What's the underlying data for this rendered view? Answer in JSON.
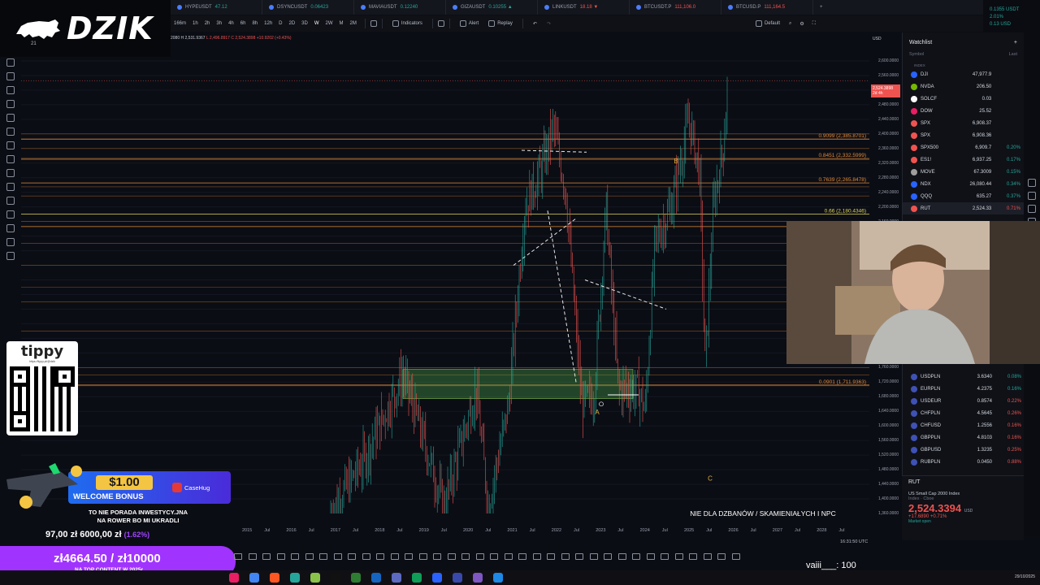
{
  "logo": {
    "text": "DZIK"
  },
  "tabs": [
    {
      "symbol": "HYPEUSDT",
      "value": "47.12",
      "neg": false
    },
    {
      "symbol": "DSYNCUSDT",
      "value": "0.06423",
      "neg": false
    },
    {
      "symbol": "MAVIAUSDT",
      "value": "0.12240",
      "neg": false
    },
    {
      "symbol": "GIZAUSDT",
      "value": "0.10255 ▲",
      "neg": false
    },
    {
      "symbol": "LINKUSDT",
      "value": "18.18 ▼",
      "neg": true
    },
    {
      "symbol": "BTCUSDT.P",
      "value": "111,106.0",
      "neg": true
    },
    {
      "symbol": "BTCUSD.P",
      "value": "111,164.5",
      "neg": true
    }
  ],
  "toolbar": {
    "timeframes": [
      "166m",
      "1h",
      "2h",
      "3h",
      "4h",
      "6h",
      "8h",
      "12h",
      "D",
      "2D",
      "3D",
      "W",
      "2W",
      "M",
      "2M"
    ],
    "indicators_label": "Indicators",
    "alert_label": "Alert",
    "replay_label": "Replay",
    "layout_label": "Default"
  },
  "corner": {
    "line1": "0.1355 USDT",
    "line2": "2.01%",
    "line3": "0.13 USD"
  },
  "ohlc": {
    "o": "2080",
    "h": "H 2,531.9367",
    "l": "L 2,496.8917",
    "c": "C 2,524.3898",
    "chg": "+10.9202 (+0.43%)"
  },
  "indicator_count": "21",
  "price_axis": {
    "currency": "USD",
    "current": "2,524.3898",
    "current_sub": "2d 4h",
    "labels": [
      "2,600.0000",
      "2,560.0000",
      "2,520.0000",
      "2,480.0000",
      "2,440.0000",
      "2,400.0000",
      "2,360.0000",
      "2,320.0000",
      "2,280.0000",
      "2,240.0000",
      "2,200.0000",
      "2,160.0000",
      "2,120.0000",
      "2,080.0000",
      "2,040.0000",
      "2,000.0000",
      "1,960.0000",
      "1,920.0000",
      "1,880.0000",
      "1,840.0000",
      "1,800.0000",
      "1,760.0000",
      "1,720.0000",
      "1,680.0000",
      "1,640.0000",
      "1,600.0000",
      "1,560.0000",
      "1,520.0000",
      "1,480.0000",
      "1,440.0000",
      "1,400.0000",
      "1,360.0000"
    ]
  },
  "time_axis": [
    "2015",
    "Jul",
    "2016",
    "Jul",
    "2017",
    "Jul",
    "2018",
    "Jul",
    "2019",
    "Jul",
    "2020",
    "Jul",
    "2021",
    "Jul",
    "2022",
    "Jul",
    "2023",
    "Jul",
    "2024",
    "Jul",
    "2025",
    "Jul",
    "2026",
    "Jul",
    "2027",
    "Jul",
    "2028",
    "Jul"
  ],
  "clock": "16:31:50 UTC",
  "chart_data": {
    "type": "candlestick",
    "fib_levels": [
      {
        "label": "0.9099 (2,385.8701)",
        "value": 2385.8701
      },
      {
        "label": "0.8451 (2,332.5999)",
        "value": 2332.5999
      },
      {
        "label": "0.7639 (2,265.8478)",
        "value": 2265.8478
      },
      {
        "label": "0.66 (2,180.4346)",
        "value": 2180.4346
      },
      {
        "label": "0.61818 (2,146.0556)",
        "value": 2146.0556
      },
      {
        "label": "0.0901 (1,711.9363)",
        "value": 1711.9363
      }
    ],
    "wave_labels": [
      "A",
      "B",
      "C"
    ],
    "ylim": [
      1360,
      2600
    ]
  },
  "watchlist": {
    "title": "Watchlist",
    "col_symbol": "Symbol",
    "col_last": "Last",
    "group": "INDEX",
    "rows": [
      {
        "sym": "DJI",
        "last": "47,977.9",
        "chg": "",
        "color": "#2962ff",
        "neg": false
      },
      {
        "sym": "NVDA",
        "last": "206.50",
        "chg": "",
        "color": "#76b900",
        "neg": false
      },
      {
        "sym": "SOLCF",
        "last": "0.03",
        "chg": "",
        "color": "#ffffff",
        "neg": false
      },
      {
        "sym": "DOW",
        "last": "25.52",
        "chg": "",
        "color": "#e91e63",
        "neg": false
      },
      {
        "sym": "SPX",
        "last": "6,908.37",
        "chg": "",
        "color": "#ef5350",
        "neg": false
      },
      {
        "sym": "SPX",
        "last": "6,908.36",
        "chg": "",
        "color": "#ef5350",
        "neg": false
      },
      {
        "sym": "SPX500",
        "last": "6,909.7",
        "chg": "0.20%",
        "color": "#ef5350",
        "neg": false
      },
      {
        "sym": "ES1!",
        "last": "6,937.25",
        "chg": "0.17%",
        "color": "#ef5350",
        "neg": false
      },
      {
        "sym": "MOVE",
        "last": "67.3009",
        "chg": "0.15%",
        "color": "#9e9e9e",
        "neg": false
      },
      {
        "sym": "NDX",
        "last": "26,080.44",
        "chg": "0.34%",
        "color": "#2962ff",
        "neg": false
      },
      {
        "sym": "QQQ",
        "last": "635.27",
        "chg": "0.37%",
        "color": "#2962ff",
        "neg": false
      },
      {
        "sym": "RUT",
        "last": "2,524.33",
        "chg": "0.71%",
        "color": "#ef5350",
        "neg": true
      }
    ],
    "fx_rows": [
      {
        "sym": "USDPLN",
        "last": "3.6340",
        "chg": "0.08%",
        "neg": false
      },
      {
        "sym": "EURPLN",
        "last": "4.2375",
        "chg": "0.16%",
        "neg": false
      },
      {
        "sym": "USDEUR",
        "last": "0.8574",
        "chg": "0.22%",
        "neg": true
      },
      {
        "sym": "CHFPLN",
        "last": "4.5645",
        "chg": "0.26%",
        "neg": true
      },
      {
        "sym": "CHFUSD",
        "last": "1.2556",
        "chg": "0.16%",
        "neg": true
      },
      {
        "sym": "GBPPLN",
        "last": "4.8103",
        "chg": "0.16%",
        "neg": true
      },
      {
        "sym": "GBPUSD",
        "last": "1.3235",
        "chg": "0.25%",
        "neg": true
      },
      {
        "sym": "RUBPLN",
        "last": "0.0450",
        "chg": "0.88%",
        "neg": true
      }
    ]
  },
  "details": {
    "symbol": "RUT",
    "name": "US Small Cap 2000 Index",
    "type": "Index · Cboe",
    "price": "2,524.3394",
    "currency": "USD",
    "change": "+17.6890 +0.71%",
    "status": "Market open",
    "low": "2,496.8917",
    "high": "2,525.1248",
    "range_label": "DAY'S RANGE"
  },
  "tippy": {
    "name": "tippy",
    "url": "https://tippy.pl/@dzik"
  },
  "banner": {
    "amount": "$1.00",
    "welcome": "WELCOME BONUS",
    "brand": "CaseHug"
  },
  "disclaimer": {
    "line1": "TO NIE PORADA INWESTYCY.JNA",
    "line2": "NA ROWER BO MI UKRADLI"
  },
  "donation": {
    "line": "97,00 zł  6000,00 zł",
    "pct": "(1.62%)"
  },
  "goal": {
    "text": "zł4664.50 / zł10000",
    "sub": "NA TOP CONTENT W 2025r."
  },
  "npc": "NIE DLA DZBANÓW / SKAMIENIAŁYCH I NPC",
  "vaiii": "vaiii___: 100",
  "taskbar": {
    "date": "29/10/2025"
  }
}
